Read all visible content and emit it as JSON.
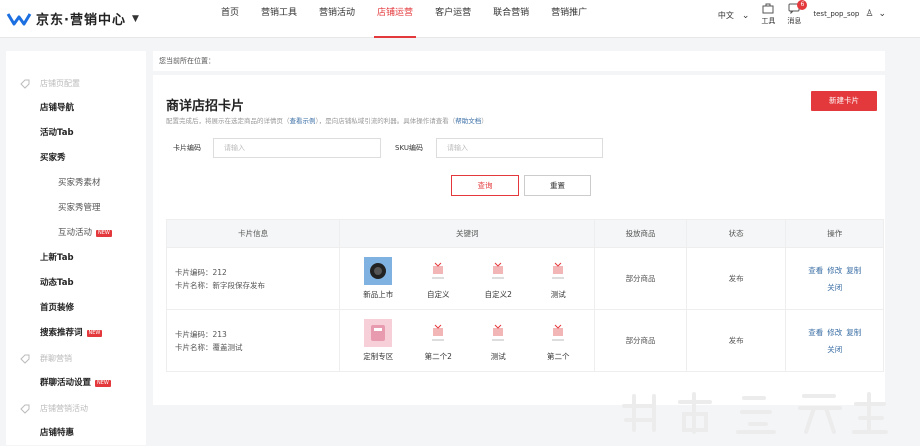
{
  "brand": {
    "name": "京东·营销中心"
  },
  "nav": [
    "首页",
    "营销工具",
    "营销活动",
    "店铺运营",
    "客户运营",
    "联合营销",
    "营销推广"
  ],
  "nav_active_index": 3,
  "topright": {
    "lang": "中文",
    "tools": "工具",
    "messages": "消息",
    "message_count": "6",
    "user": "test_pop_sop"
  },
  "sidebar": {
    "group1": "店铺页配置",
    "items1": [
      "店铺导航",
      "活动Tab",
      "买家秀"
    ],
    "subs": [
      "买家秀素材",
      "买家秀管理",
      "互动活动"
    ],
    "items2": [
      "上新Tab",
      "动态Tab",
      "首页装修",
      "搜索推荐词"
    ],
    "group2": "群聊营销",
    "item_group": "群聊活动设置",
    "group3": "店铺营销活动",
    "item_last": "店铺特惠",
    "new_tag": "NEW"
  },
  "breadcrumb": "您当前所在位置：",
  "page": {
    "title": "商详店招卡片",
    "desc_a": "配置完成后，将展示在选定商品的详情页（",
    "desc_link1": "查看示例",
    "desc_b": "），是向店铺私域引流的利器。具体操作请查看（",
    "desc_link2": "帮助文档",
    "desc_c": "）",
    "new_button": "新建卡片"
  },
  "filters": {
    "card_code_label": "卡片编码",
    "card_code_placeholder": "请输入",
    "sku_label": "SKU编码",
    "sku_placeholder": "请输入",
    "query": "查询",
    "reset": "重置"
  },
  "table": {
    "headers": [
      "卡片信息",
      "关键词",
      "投放商品",
      "状态",
      "操作"
    ],
    "rows": [
      {
        "code": "卡片编码：212",
        "name": "卡片名称：新字段保存发布",
        "keywords": [
          "新品上市",
          "自定义",
          "自定义2",
          "测试"
        ],
        "goods": "部分商品",
        "status": "发布",
        "ops": [
          "查看",
          "修改",
          "复制",
          "关闭"
        ]
      },
      {
        "code": "卡片编码：213",
        "name": "卡片名称：覆盖测试",
        "keywords": [
          "定制专区",
          "第二个2",
          "测试",
          "第二个"
        ],
        "goods": "部分商品",
        "status": "发布",
        "ops": [
          "查看",
          "修改",
          "复制",
          "关闭"
        ]
      }
    ]
  },
  "colors": {
    "accent": "#e4393c",
    "link": "#3a6ea5",
    "logo": "#1c6fe0"
  }
}
